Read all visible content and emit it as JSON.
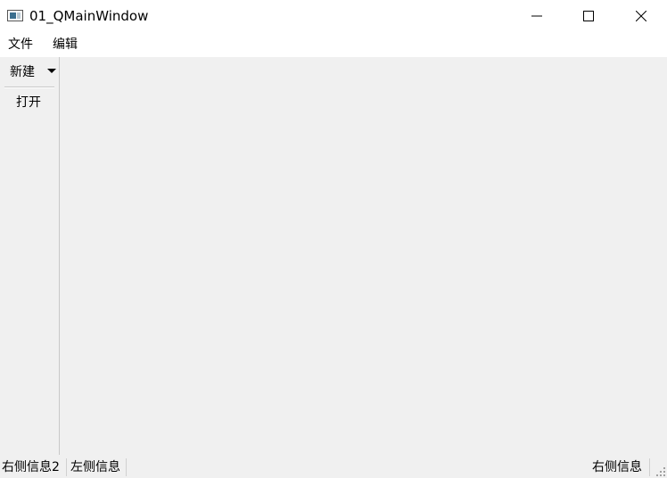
{
  "window": {
    "title": "01_QMainWindow",
    "icon": "app-window-icon",
    "controls": [
      "minimize-icon",
      "maximize-icon",
      "close-icon"
    ]
  },
  "menubar": {
    "items": [
      {
        "label": "文件"
      },
      {
        "label": "编辑"
      }
    ]
  },
  "toolbar": {
    "items": [
      {
        "label": "新建",
        "has_dropdown": true
      },
      {
        "label": "打开"
      }
    ]
  },
  "statusbar": {
    "left_items": [
      "右侧信息2",
      "左侧信息"
    ],
    "right_items": [
      "右侧信息"
    ]
  },
  "colors": {
    "titlebar_bg": "#ffffff",
    "menubar_bg": "#ffffff",
    "client_bg": "#f0f0f0",
    "border": "#c8c8c8"
  }
}
